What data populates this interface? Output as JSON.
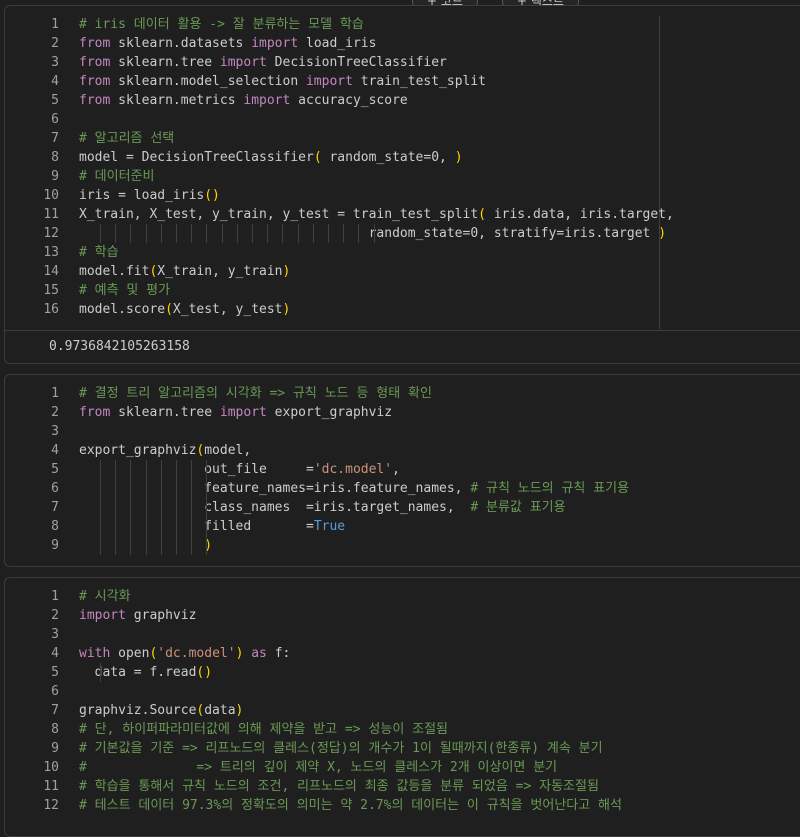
{
  "toolbar": {
    "code_label": "+ 코드",
    "text_label": "+ 텍스트"
  },
  "cell1": {
    "lines": [
      {
        "n": "1",
        "segs": [
          {
            "t": "# iris 데이터 활용 -> 잘 분류하는 모델 학습",
            "c": "c"
          }
        ]
      },
      {
        "n": "2",
        "segs": [
          {
            "t": "from",
            "c": "k"
          },
          {
            "t": " sklearn.datasets "
          },
          {
            "t": "import",
            "c": "k"
          },
          {
            "t": " load_iris"
          }
        ]
      },
      {
        "n": "3",
        "segs": [
          {
            "t": "from",
            "c": "k"
          },
          {
            "t": " sklearn.tree "
          },
          {
            "t": "import",
            "c": "k"
          },
          {
            "t": " DecisionTreeClassifier"
          }
        ]
      },
      {
        "n": "4",
        "segs": [
          {
            "t": "from",
            "c": "k"
          },
          {
            "t": " sklearn.model_selection "
          },
          {
            "t": "import",
            "c": "k"
          },
          {
            "t": " train_test_split"
          }
        ]
      },
      {
        "n": "5",
        "segs": [
          {
            "t": "from",
            "c": "k"
          },
          {
            "t": " sklearn.metrics "
          },
          {
            "t": "import",
            "c": "k"
          },
          {
            "t": " accuracy_score"
          }
        ]
      },
      {
        "n": "6",
        "segs": []
      },
      {
        "n": "7",
        "segs": [
          {
            "t": "# 알고리즘 선택",
            "c": "c"
          }
        ]
      },
      {
        "n": "8",
        "segs": [
          {
            "t": "model = DecisionTreeClassifier"
          },
          {
            "t": "(",
            "c": "p"
          },
          {
            "t": " random_state=0, "
          },
          {
            "t": ")",
            "c": "p"
          }
        ]
      },
      {
        "n": "9",
        "segs": [
          {
            "t": "# 데이터준비",
            "c": "c"
          }
        ]
      },
      {
        "n": "10",
        "segs": [
          {
            "t": "iris = load_iris"
          },
          {
            "t": "()",
            "c": "p"
          }
        ]
      },
      {
        "n": "11",
        "segs": [
          {
            "t": "X_train, X_test, y_train, y_test = train_test_split"
          },
          {
            "t": "(",
            "c": "p"
          },
          {
            "t": " iris.data, iris.target,"
          }
        ]
      },
      {
        "n": "12",
        "guides": 19,
        "segs": [
          {
            "t": "                                     random_state=0, stratify=iris.target "
          },
          {
            "t": ")",
            "c": "p"
          }
        ]
      },
      {
        "n": "13",
        "segs": [
          {
            "t": "# 학습",
            "c": "c"
          }
        ]
      },
      {
        "n": "14",
        "segs": [
          {
            "t": "model.fit"
          },
          {
            "t": "(",
            "c": "p"
          },
          {
            "t": "X_train, y_train"
          },
          {
            "t": ")",
            "c": "p"
          }
        ]
      },
      {
        "n": "15",
        "segs": [
          {
            "t": "# 예측 및 평가",
            "c": "c"
          }
        ]
      },
      {
        "n": "16",
        "segs": [
          {
            "t": "model.score"
          },
          {
            "t": "(",
            "c": "p"
          },
          {
            "t": "X_test, y_test"
          },
          {
            "t": ")",
            "c": "p"
          }
        ]
      }
    ],
    "output": "0.9736842105263158"
  },
  "cell2": {
    "lines": [
      {
        "n": "1",
        "segs": [
          {
            "t": "# 결정 트리 알고리즘의 시각화 => 규칙 노드 등 형태 확인",
            "c": "c"
          }
        ]
      },
      {
        "n": "2",
        "segs": [
          {
            "t": "from",
            "c": "k"
          },
          {
            "t": " sklearn.tree "
          },
          {
            "t": "import",
            "c": "k"
          },
          {
            "t": " export_graphviz"
          }
        ]
      },
      {
        "n": "3",
        "segs": []
      },
      {
        "n": "4",
        "segs": [
          {
            "t": "export_graphviz"
          },
          {
            "t": "(",
            "c": "p"
          },
          {
            "t": "model,"
          }
        ]
      },
      {
        "n": "5",
        "guides": 8,
        "segs": [
          {
            "t": "                out_file     ="
          },
          {
            "t": "'dc.model'",
            "c": "s"
          },
          {
            "t": ","
          }
        ]
      },
      {
        "n": "6",
        "guides": 8,
        "segs": [
          {
            "t": "                feature_names=iris.feature_names, "
          },
          {
            "t": "# 규칙 노드의 규칙 표기용",
            "c": "c"
          }
        ]
      },
      {
        "n": "7",
        "guides": 8,
        "segs": [
          {
            "t": "                class_names  =iris.target_names,  "
          },
          {
            "t": "# 분류값 표기용",
            "c": "c"
          }
        ]
      },
      {
        "n": "8",
        "guides": 8,
        "segs": [
          {
            "t": "                filled       ="
          },
          {
            "t": "True",
            "c": "b"
          }
        ]
      },
      {
        "n": "9",
        "guides": 8,
        "segs": [
          {
            "t": "                "
          },
          {
            "t": ")",
            "c": "p"
          }
        ]
      }
    ]
  },
  "cell3": {
    "lines": [
      {
        "n": "1",
        "segs": [
          {
            "t": "# 시각화",
            "c": "c"
          }
        ]
      },
      {
        "n": "2",
        "segs": [
          {
            "t": "import",
            "c": "k"
          },
          {
            "t": " graphviz"
          }
        ]
      },
      {
        "n": "3",
        "segs": []
      },
      {
        "n": "4",
        "segs": [
          {
            "t": "with",
            "c": "k"
          },
          {
            "t": " open"
          },
          {
            "t": "(",
            "c": "p"
          },
          {
            "t": "'dc.model'",
            "c": "s"
          },
          {
            "t": ")",
            "c": "p"
          },
          {
            "t": " as",
            "c": "k"
          },
          {
            "t": " f:"
          }
        ]
      },
      {
        "n": "5",
        "guides": 1,
        "segs": [
          {
            "t": "  data = f.read"
          },
          {
            "t": "()",
            "c": "p"
          }
        ]
      },
      {
        "n": "6",
        "segs": []
      },
      {
        "n": "7",
        "segs": [
          {
            "t": "graphviz.Source"
          },
          {
            "t": "(",
            "c": "p"
          },
          {
            "t": "data"
          },
          {
            "t": ")",
            "c": "p"
          }
        ]
      },
      {
        "n": "8",
        "segs": [
          {
            "t": "# 단, 하이퍼파라미터값에 의해 제약을 받고 => 성능이 조절됨",
            "c": "c"
          }
        ]
      },
      {
        "n": "9",
        "segs": [
          {
            "t": "# 기본값을 기준 => 리프노드의 클레스(정답)의 개수가 1이 될때까지(한종류) 계속 분기",
            "c": "c"
          }
        ]
      },
      {
        "n": "10",
        "segs": [
          {
            "t": "#              => 트리의 깊이 제약 X, 노드의 클레스가 2개 이상이면 분기",
            "c": "c"
          }
        ]
      },
      {
        "n": "11",
        "segs": [
          {
            "t": "# 학습을 통해서 규칙 노드의 조건, 리프노드의 최종 값등을 분류 되었음 => 자동조절됨",
            "c": "c"
          }
        ]
      },
      {
        "n": "12",
        "segs": [
          {
            "t": "# 테스트 데이터 97.3%의 정확도의 의미는 약 2.7%의 데이터는 이 규칙을 벗어난다고 해석",
            "c": "c"
          }
        ]
      }
    ]
  }
}
